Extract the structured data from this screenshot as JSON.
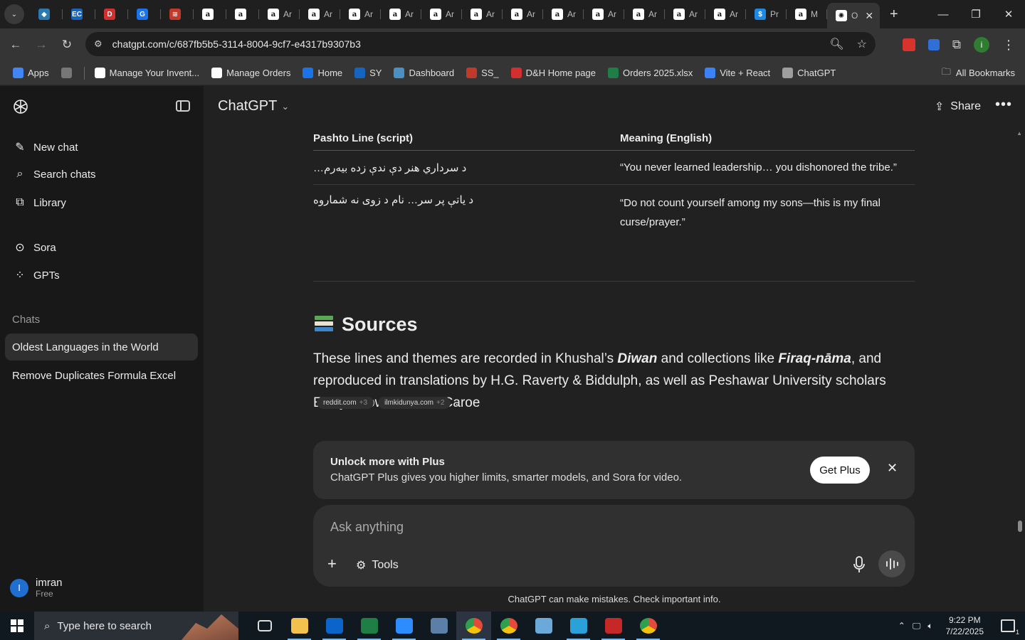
{
  "browser": {
    "tabs": [
      {
        "icon": "kite-icon",
        "label": ""
      },
      {
        "icon": "ec-icon",
        "label": ""
      },
      {
        "icon": "dh-icon",
        "label": ""
      },
      {
        "icon": "docs-icon",
        "label": ""
      },
      {
        "icon": "stack-icon",
        "label": ""
      },
      {
        "icon": "amazon-icon",
        "label": ""
      },
      {
        "icon": "amazon-icon",
        "label": ""
      },
      {
        "icon": "amazon-icon",
        "label": "Ar"
      },
      {
        "icon": "amazon-icon",
        "label": "Ar"
      },
      {
        "icon": "amazon-icon",
        "label": "Ar"
      },
      {
        "icon": "amazon-icon",
        "label": "Ar"
      },
      {
        "icon": "amazon-icon",
        "label": "Ar"
      },
      {
        "icon": "amazon-icon",
        "label": "Ar"
      },
      {
        "icon": "amazon-icon",
        "label": "Ar"
      },
      {
        "icon": "amazon-icon",
        "label": "Ar"
      },
      {
        "icon": "amazon-icon",
        "label": "Ar"
      },
      {
        "icon": "amazon-icon",
        "label": "Ar"
      },
      {
        "icon": "amazon-icon",
        "label": "Ar"
      },
      {
        "icon": "amazon-icon",
        "label": "Ar"
      },
      {
        "icon": "dollar-icon",
        "label": "Pr"
      },
      {
        "icon": "amazon-icon",
        "label": "M"
      }
    ],
    "active_tab": {
      "label": "O",
      "close": "✕"
    },
    "new_tab": "+",
    "url": "chatgpt.com/c/687fb5b5-3114-8004-9cf7-e4317b9307b3",
    "bookmarks": [
      {
        "label": "Apps",
        "color": "#4285f4"
      },
      {
        "label": "",
        "color": "#777777"
      },
      {
        "label": "Manage Your Invent...",
        "color": "#ffffff"
      },
      {
        "label": "Manage Orders",
        "color": "#ffffff"
      },
      {
        "label": "Home",
        "color": "#1a73e8"
      },
      {
        "label": "SY",
        "color": "#1565c0"
      },
      {
        "label": "Dashboard",
        "color": "#4a90c2"
      },
      {
        "label": "SS_",
        "color": "#c0392b"
      },
      {
        "label": "D&H Home page",
        "color": "#d32f2f"
      },
      {
        "label": "Orders 2025.xlsx",
        "color": "#1e7e45"
      },
      {
        "label": "Vite + React",
        "color": "#3b82f6"
      },
      {
        "label": "ChatGPT",
        "color": "#9e9e9e"
      }
    ],
    "all_bookmarks": "All Bookmarks"
  },
  "sidebar": {
    "new_chat": "New chat",
    "search_chats": "Search chats",
    "library": "Library",
    "sora": "Sora",
    "gpts": "GPTs",
    "chats_label": "Chats",
    "chats": [
      {
        "label": "Oldest Languages in the World",
        "active": true
      },
      {
        "label": "Remove Duplicates Formula Excel",
        "active": false
      }
    ],
    "user": {
      "initial": "I",
      "name": "imran",
      "plan": "Free"
    }
  },
  "main": {
    "model": "ChatGPT",
    "share": "Share",
    "table": {
      "headers": [
        "Pashto Line (script)",
        "Meaning (English)"
      ],
      "rows": [
        [
          "د سرداري هنر دې ندې زده بيه‌رم…",
          "“You never learned leadership… you dishonored the tribe.”"
        ],
        [
          "د ياتې پر سر… نام د زوی نه شماروه",
          "“Do not count yourself among my sons—this is my final curse/prayer.”"
        ]
      ]
    },
    "sources_heading": "Sources",
    "para_1": "These lines and themes are recorded in Khushal’s ",
    "para_em1": "Diwan",
    "para_2": " and collections like ",
    "para_em2": "Firaq-nāma",
    "para_3": ", and reproduced in translations by H.G. Raverty & Biddulph, as well as Peshawar University scholars Evelyn Howell & Olaf Caroe",
    "chips": [
      {
        "site": "reddit.com",
        "more": "+3"
      },
      {
        "site": "ilmkidunya.com",
        "more": "+2"
      }
    ],
    "chip_trail": ".",
    "plus_card": {
      "title": "Unlock more with Plus",
      "subtitle": "ChatGPT Plus gives you higher limits, smarter models, and Sora for video.",
      "button": "Get Plus"
    },
    "composer": {
      "placeholder": "Ask anything",
      "tools": "Tools"
    },
    "disclaimer": "ChatGPT can make mistakes. Check important info."
  },
  "taskbar": {
    "search_placeholder": "Type here to search",
    "apps": [
      {
        "icon": "task-view-icon",
        "color": "#101820"
      },
      {
        "icon": "file-explorer-icon",
        "color": "#f2c14e"
      },
      {
        "icon": "outlook-icon",
        "color": "#0a64c9"
      },
      {
        "icon": "excel-icon",
        "color": "#1e7e45"
      },
      {
        "icon": "zoom-icon",
        "color": "#2d8cff"
      },
      {
        "icon": "calculator-icon",
        "color": "#5b7fa6"
      },
      {
        "icon": "chrome-icon",
        "color": "#e24b3b"
      },
      {
        "icon": "chrome-icon",
        "color": "#e24b3b"
      },
      {
        "icon": "app-icon",
        "color": "#6aa9d8"
      },
      {
        "icon": "vscode-icon",
        "color": "#2aa1d8"
      },
      {
        "icon": "filezilla-icon",
        "color": "#c62828"
      },
      {
        "icon": "chrome-icon",
        "color": "#e24b3b"
      }
    ],
    "time": "9:22 PM",
    "date": "7/22/2025",
    "notifications": "1"
  }
}
